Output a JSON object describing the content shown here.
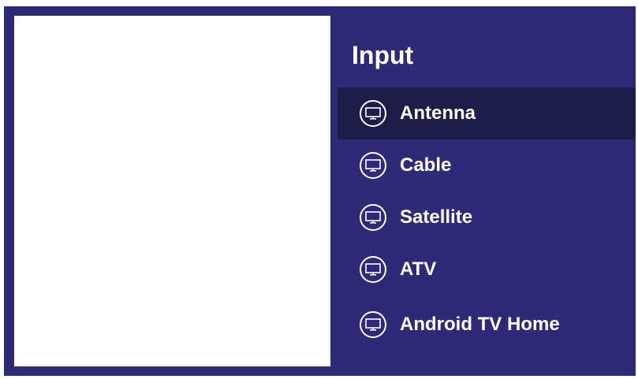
{
  "panel": {
    "title": "Input"
  },
  "inputs": [
    {
      "label": "Antenna",
      "icon": "tv-icon",
      "selected": true
    },
    {
      "label": "Cable",
      "icon": "tv-icon",
      "selected": false
    },
    {
      "label": "Satellite",
      "icon": "tv-icon",
      "selected": false
    },
    {
      "label": "ATV",
      "icon": "tv-icon",
      "selected": false
    },
    {
      "label": "Android TV Home",
      "icon": "tv-icon",
      "selected": false
    }
  ],
  "colors": {
    "background": "#2e2a78",
    "selected_row": "#1e1c49",
    "preview": "#ffffff",
    "text": "#ffffff"
  }
}
